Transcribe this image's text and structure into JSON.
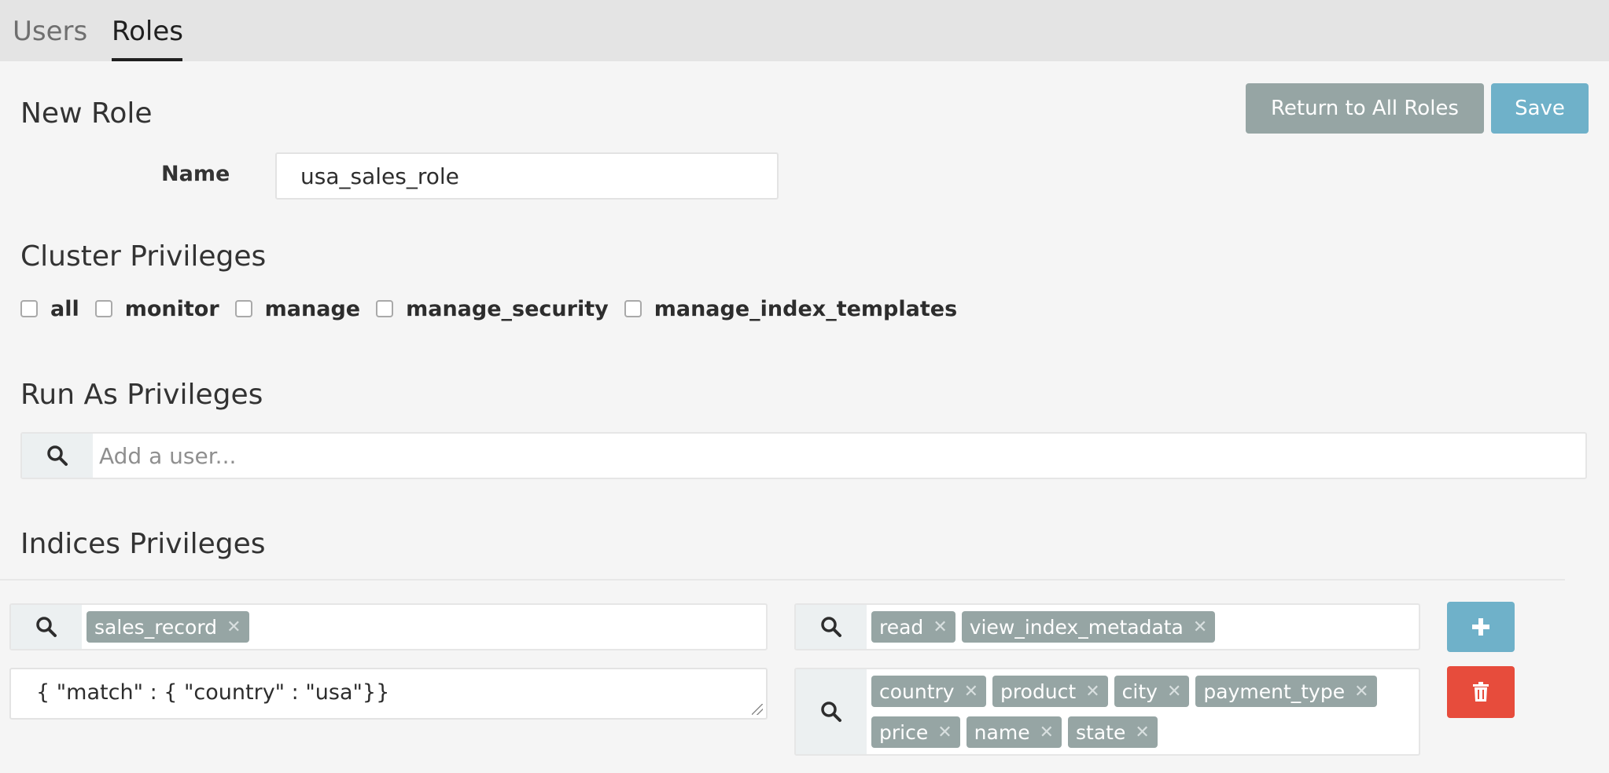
{
  "tabs": [
    "Users",
    "Roles"
  ],
  "page_title": "New Role",
  "actions": {
    "return_label": "Return to All Roles",
    "save_label": "Save"
  },
  "name_field": {
    "label": "Name",
    "value": "usa_sales_role"
  },
  "cluster": {
    "title": "Cluster Privileges",
    "options": [
      "all",
      "monitor",
      "manage",
      "manage_security",
      "manage_index_templates"
    ]
  },
  "run_as": {
    "title": "Run As Privileges",
    "placeholder": "Add a user..."
  },
  "indices": {
    "title": "Indices Privileges",
    "index_tags": [
      "sales_record"
    ],
    "privilege_tags": [
      "read",
      "view_index_metadata"
    ],
    "query": "{ \"match\" : { \"country\" : \"usa\"}}",
    "field_tags": [
      "country",
      "product",
      "city",
      "payment_type",
      "price",
      "name",
      "state"
    ]
  },
  "colors": {
    "accent_blue": "#6fb1c9",
    "gray_button": "#96a5a4",
    "delete_red": "#e74c3c"
  },
  "icons": {
    "search": "search-icon",
    "add": "plus-icon",
    "delete": "trash-icon",
    "tag_remove": "close-icon"
  }
}
